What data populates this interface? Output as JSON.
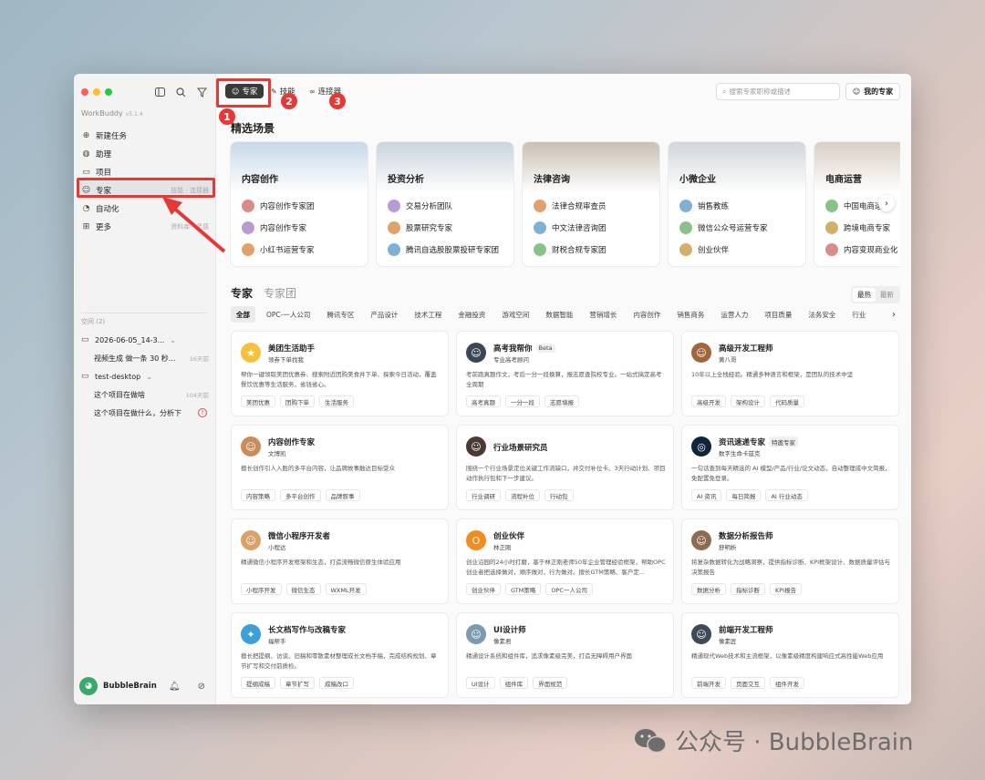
{
  "colors": {
    "close": "#ff5f57",
    "minimize": "#febc2e",
    "maximize": "#28c840",
    "accent": "#e53935"
  },
  "sidebar": {
    "brand": "WorkBuddy",
    "version": "v5.1.4",
    "nav": [
      {
        "label": "新建任务",
        "icon": "plus-circle-icon",
        "hint": ""
      },
      {
        "label": "助理",
        "icon": "assistant-icon",
        "hint": ""
      },
      {
        "label": "项目",
        "icon": "project-icon",
        "hint": ""
      },
      {
        "label": "专家",
        "icon": "expert-icon",
        "hint": "技能 · 连接器"
      },
      {
        "label": "自动化",
        "icon": "automation-icon",
        "hint": ""
      },
      {
        "label": "更多",
        "icon": "grid-icon",
        "hint": "资料库 · 灵感"
      }
    ],
    "space_heading": "空间 (2)",
    "tree": [
      {
        "label": "2026-06-05_14-3...",
        "meta": "",
        "type": "folder"
      },
      {
        "label": "视频生成 做一条 30 秒...",
        "meta": "16天前",
        "type": "task"
      },
      {
        "label": "test-desktop",
        "meta": "",
        "type": "folder"
      },
      {
        "label": "这个项目在做啥",
        "meta": "104天前",
        "type": "task"
      },
      {
        "label": "这个项目在做什么，分析下",
        "meta": "!",
        "type": "task"
      }
    ],
    "user": "BubbleBrain"
  },
  "topbar": {
    "tabs": [
      {
        "label": "专家"
      },
      {
        "label": "技能"
      },
      {
        "label": "连接器"
      }
    ],
    "search_placeholder": "搜索专家职称或描述",
    "my_experts": "我的专家"
  },
  "featured": {
    "title": "精选场景",
    "scenes": [
      {
        "title": "内容创作",
        "color": "#c7d9ea",
        "items": [
          "内容创作专家团",
          "内容创作专家",
          "小红书运营专家"
        ]
      },
      {
        "title": "投资分析",
        "color": "#c9d4dc",
        "items": [
          "交易分析团队",
          "股票研究专家",
          "腾讯自选股股票投研专家团"
        ]
      },
      {
        "title": "法律咨询",
        "color": "#c9bfb3",
        "items": [
          "法律合规审查员",
          "中文法律咨询团",
          "财税合规专家团"
        ]
      },
      {
        "title": "小微企业",
        "color": "#d2d6da",
        "items": [
          "销售教练",
          "微信公众号运营专家",
          "创业伙伴"
        ]
      },
      {
        "title": "电商运营",
        "color": "#d9cfc6",
        "items": [
          "中国电商运营",
          "跨境电商专家",
          "内容变现商业化"
        ]
      }
    ]
  },
  "experts": {
    "tab_active": "专家",
    "tab_other": "专家团",
    "sort": [
      "最热",
      "最新"
    ],
    "categories": [
      "全部",
      "OPC-一人公司",
      "腾讯专区",
      "产品设计",
      "技术工程",
      "金融投资",
      "游戏空间",
      "数据智能",
      "营销增长",
      "内容创作",
      "销售商务",
      "运营人力",
      "项目质量",
      "法务安全",
      "行业"
    ],
    "cards": [
      {
        "name": "美团生活助手",
        "badge": "",
        "sub": "领券下单找我",
        "desc": "帮你一键领取美团优惠券、搜索附近团购美食并下单、探索今日活动，覆盖餐饮优惠等生活服务，省钱省心。",
        "tags": [
          "美团优惠",
          "团购下单",
          "生活服务"
        ],
        "color": "#f5c33b",
        "icon": "kangaroo-icon"
      },
      {
        "name": "高考我帮你",
        "badge": "Beta",
        "sub": "专业高考顾问",
        "desc": "考前跑真题作文，考后一分一段换算，报志愿查院校专业。一站式搞定高考全周期",
        "tags": [
          "高考真题",
          "一分一段",
          "志愿填报"
        ],
        "color": "#3b4656",
        "icon": "avatar-icon"
      },
      {
        "name": "高级开发工程师",
        "badge": "",
        "sub": "黄八哥",
        "desc": "10年以上全栈经验。精通多种语言和框架，是团队的技术中坚",
        "tags": [
          "高级开发",
          "架构设计",
          "代码质量"
        ],
        "color": "#a2663f",
        "icon": "avatar-icon"
      },
      {
        "name": "内容创作专家",
        "badge": "",
        "sub": "文博凯",
        "desc": "擅长创作引人入胜的多平台内容，让品牌故事触达目标受众",
        "tags": [
          "内容策略",
          "多平台创作",
          "品牌叙事"
        ],
        "color": "#c98d5a",
        "icon": "avatar-icon"
      },
      {
        "name": "行业场景研究员",
        "badge": "",
        "sub": "",
        "desc": "围绕一个行业场景定位关键工作流缺口，并交付补位卡、3天行动计划、项目动作执行包和下一步建议。",
        "tags": [
          "行业调研",
          "流程补位",
          "行动包"
        ],
        "color": "#4a3a32",
        "icon": "avatar-icon"
      },
      {
        "name": "资讯速递专家",
        "badge": "特邀专家",
        "sub": "数字生命卡兹克",
        "desc": "一句话查到每天精选的 AI 模型/产品/行业/论文动态，自动整理成中文简报，免配置免登录。",
        "tags": [
          "AI 资讯",
          "每日简报",
          "AI 行业动态"
        ],
        "color": "#10243c",
        "icon": "orbit-icon"
      },
      {
        "name": "微信小程序开发者",
        "badge": "",
        "sub": "小程达",
        "desc": "精通微信小程序开发框架和生态，打造流畅微信原生体验应用",
        "tags": [
          "小程序开发",
          "微信生态",
          "WXML开发"
        ],
        "color": "#d9a26a",
        "icon": "avatar-icon"
      },
      {
        "name": "创业伙伴",
        "badge": "",
        "sub": "林正刚",
        "desc": "创业沿园的24小时打磨，基于林正刚老师50年企业管理经验框架，帮助OPC创业者把选择做对，顺序做对，行为做对。擅长GTM策略、客户定...",
        "tags": [
          "创业伙伴",
          "GTM策略",
          "OPC一人公司"
        ],
        "color": "#f28b20",
        "icon": "opc-logo-icon"
      },
      {
        "name": "数据分析报告师",
        "badge": "",
        "sub": "舒明析",
        "desc": "将复杂数据转化为战略洞察，提供指标诊断、KPI框架设计、数据质量评估与决策报告",
        "tags": [
          "数据分析",
          "指标诊断",
          "KPI报告"
        ],
        "color": "#8c6a54",
        "icon": "avatar-icon"
      },
      {
        "name": "长文档写作与改稿专家",
        "badge": "",
        "sub": "福帮手",
        "desc": "擅长把提纲、访谈、旧稿和零散素材整理成长文档手稿，完成结构规划、章节扩写和交付前质检。",
        "tags": [
          "提纲成稿",
          "章节扩写",
          "成稿改口"
        ],
        "color": "#3aa0d8",
        "icon": "butterfly-icon"
      },
      {
        "name": "UI设计师",
        "badge": "",
        "sub": "像素君",
        "desc": "精通设计系统和组件库，追求像素级完美，打造无障碍用户界面",
        "tags": [
          "UI设计",
          "组件库",
          "界面规范"
        ],
        "color": "#7c9bb0",
        "icon": "avatar-icon"
      },
      {
        "name": "前端开发工程师",
        "badge": "",
        "sub": "像素匠",
        "desc": "精通现代Web技术和主流框架，以像素级精度构建响应式高性能Web应用",
        "tags": [
          "前端开发",
          "页面交互",
          "组件开发"
        ],
        "color": "#3d4a5a",
        "icon": "avatar-icon"
      }
    ]
  },
  "annotations": [
    "1",
    "2",
    "3"
  ],
  "watermark": "公众号 · BubbleBrain"
}
